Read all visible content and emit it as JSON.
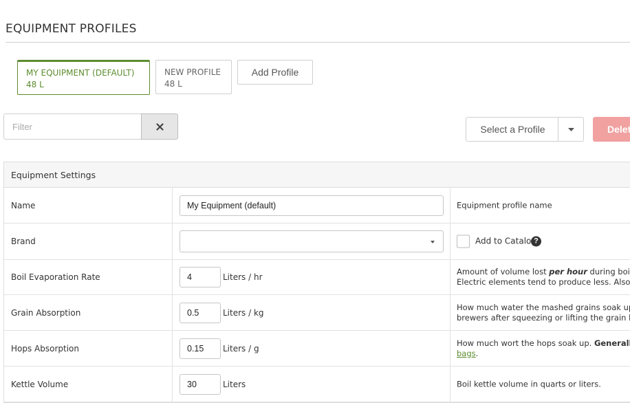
{
  "page": {
    "title": "EQUIPMENT PROFILES"
  },
  "profiles": [
    {
      "name": "MY EQUIPMENT (DEFAULT)",
      "volume": "48 L",
      "active": true
    },
    {
      "name": "NEW PROFILE",
      "volume": "48 L",
      "active": false
    }
  ],
  "add_profile_label": "Add Profile",
  "filter": {
    "placeholder": "Filter",
    "value": ""
  },
  "clear_icon": "close-icon",
  "select_profile": {
    "label": "Select a Profile"
  },
  "delete_label": "Delete",
  "settings": {
    "header": "Equipment Settings",
    "rows": [
      {
        "label": "Name",
        "input_value": "My Equipment (default)",
        "description": "Equipment profile name"
      },
      {
        "label": "Brand",
        "input_value": "",
        "checkbox_label": "Add to Catalog"
      },
      {
        "label": "Boil Evaporation Rate",
        "input_value": "4",
        "unit": "Liters / hr",
        "description_lines": [
          {
            "parts": [
              {
                "t": "Amount of volume lost ",
                "s": ""
              },
              {
                "t": "per hour",
                "s": "em"
              },
              {
                "t": " during boil in",
                "s": ""
              }
            ]
          },
          {
            "parts": [
              {
                "t": "Electric elements tend to produce less. Also d",
                "s": ""
              }
            ]
          }
        ]
      },
      {
        "label": "Grain Absorption",
        "input_value": "0.5",
        "unit": "Liters / kg",
        "description_lines": [
          {
            "parts": [
              {
                "t": "How much water the mashed grains soak up.",
                "s": ""
              }
            ]
          },
          {
            "parts": [
              {
                "t": "brewers after squeezing or lifting the grain ba",
                "s": ""
              }
            ]
          }
        ]
      },
      {
        "label": "Hops Absorption",
        "input_value": "0.15",
        "unit": "Liters / g",
        "description_lines": [
          {
            "parts": [
              {
                "t": "How much wort the hops soak up. ",
                "s": ""
              },
              {
                "t": "Generally",
                "s": "strong"
              }
            ]
          },
          {
            "parts": [
              {
                "t": "bags",
                "s": "link"
              },
              {
                "t": ".",
                "s": ""
              }
            ]
          }
        ]
      },
      {
        "label": "Kettle Volume",
        "input_value": "30",
        "unit": "Liters",
        "description": "Boil kettle volume in quarts or liters."
      }
    ]
  },
  "colors": {
    "accent_green": "#5c8c2e",
    "delete_bg": "#f0a1a0"
  }
}
